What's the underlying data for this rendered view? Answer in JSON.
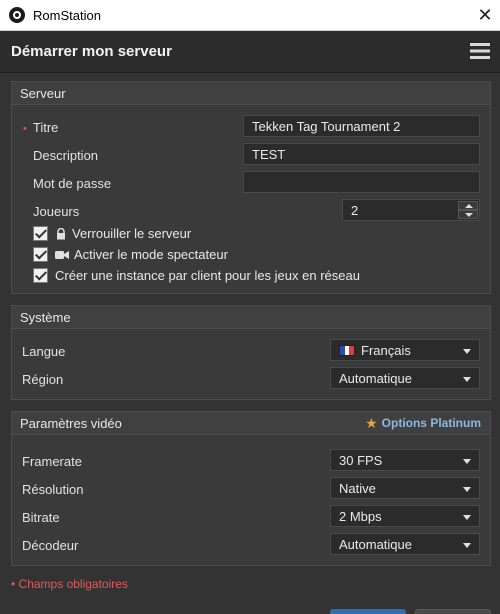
{
  "window": {
    "app_title": "RomStation",
    "close_glyph": "✕"
  },
  "header": {
    "title": "Démarrer mon serveur"
  },
  "required_marker": "•",
  "server": {
    "section_title": "Serveur",
    "title_label": "Titre",
    "title_value": "Tekken Tag Tournament 2",
    "description_label": "Description",
    "description_value": "TEST",
    "password_label": "Mot de passe",
    "password_value": "",
    "players_label": "Joueurs",
    "players_value": "2",
    "checkboxes": [
      {
        "label": "Verrouiller le serveur",
        "icon": "lock-icon",
        "checked": true
      },
      {
        "label": "Activer le mode spectateur",
        "icon": "camera-icon",
        "checked": true
      },
      {
        "label": "Créer une instance par client pour les jeux en réseau",
        "icon": "",
        "checked": true
      }
    ]
  },
  "system": {
    "section_title": "Système",
    "language_label": "Langue",
    "language_value": "Français",
    "language_flag": [
      "#2b4ea2",
      "#ffffff",
      "#e03a3e"
    ],
    "region_label": "Région",
    "region_value": "Automatique"
  },
  "video": {
    "section_title": "Paramètres vidéo",
    "platinum_label": "Options Platinum",
    "framerate_label": "Framerate",
    "framerate_value": "30 FPS",
    "resolution_label": "Résolution",
    "resolution_value": "Native",
    "bitrate_label": "Bitrate",
    "bitrate_value": "2 Mbps",
    "decoder_label": "Décodeur",
    "decoder_value": "Automatique"
  },
  "footer": {
    "required_note": "Champs obligatoires"
  },
  "colors": {
    "accent_blue": "#2e6fb7",
    "required_red": "#e05a5a",
    "platinum_star": "#e8a33a"
  }
}
